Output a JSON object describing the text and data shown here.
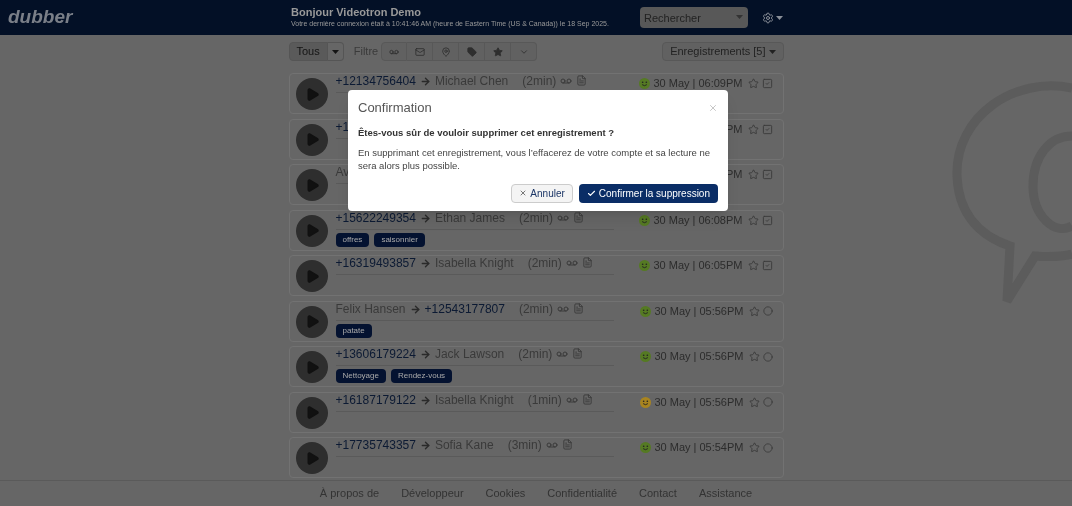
{
  "header": {
    "logo": "dubber",
    "greeting": "Bonjour Videotron Demo",
    "last_login": "Votre dernière connexion était à 10:41:46 AM (heure de Eastern Time (US & Canada)) le 18 Sep 2025.",
    "search": {
      "placeholder": "Rechercher"
    }
  },
  "toolbar": {
    "scope": "Tous",
    "filter_label": "Filtre",
    "recordings": "Enregistrements [5]"
  },
  "rows": [
    {
      "parties": [
        {
          "text": "+12134756404",
          "kind": "number"
        },
        {
          "text": "Michael Chen",
          "kind": "name"
        }
      ],
      "duration": "(2min)",
      "color": "#557a23",
      "date": "30 May | 06:09PM",
      "checked": true,
      "tags": []
    },
    {
      "parties": [
        {
          "text": "+1",
          "kind": "number"
        }
      ],
      "date": "PM",
      "checked": true,
      "tags": []
    },
    {
      "parties": [
        {
          "text": "Av",
          "kind": "name"
        }
      ],
      "date": "PM",
      "checked": true,
      "tags": []
    },
    {
      "parties": [
        {
          "text": "+15622249354",
          "kind": "number"
        },
        {
          "text": "Ethan James",
          "kind": "name"
        }
      ],
      "duration": "(2min)",
      "color": "#557a23",
      "date": "30 May | 06:08PM",
      "checked": true,
      "tags": [
        "offres",
        "saisonnier"
      ]
    },
    {
      "parties": [
        {
          "text": "+16319493857",
          "kind": "number"
        },
        {
          "text": "Isabella Knight",
          "kind": "name"
        }
      ],
      "duration": "(2min)",
      "color": "#557a23",
      "date": "30 May | 06:05PM",
      "checked": true,
      "tags": []
    },
    {
      "parties": [
        {
          "text": "Felix Hansen",
          "kind": "name"
        },
        {
          "text": "+12543177807",
          "kind": "number"
        }
      ],
      "duration": "(2min)",
      "color": "#557a23",
      "date": "30 May | 05:56PM",
      "checked": false,
      "tags": [
        "patate"
      ]
    },
    {
      "parties": [
        {
          "text": "+13606179224",
          "kind": "number"
        },
        {
          "text": "Jack Lawson",
          "kind": "name"
        }
      ],
      "duration": "(2min)",
      "color": "#557a23",
      "date": "30 May | 05:56PM",
      "checked": false,
      "tags": [
        "Nettoyage",
        "Rendez-vous"
      ]
    },
    {
      "parties": [
        {
          "text": "+16187179122",
          "kind": "number"
        },
        {
          "text": "Isabella Knight",
          "kind": "name"
        }
      ],
      "duration": "(1min)",
      "color": "#a88420",
      "date": "30 May | 05:56PM",
      "checked": false,
      "tags": []
    },
    {
      "parties": [
        {
          "text": "+17735743357",
          "kind": "number"
        },
        {
          "text": "Sofia Kane",
          "kind": "name"
        }
      ],
      "duration": "(3min)",
      "color": "#557a23",
      "date": "30 May | 05:54PM",
      "checked": false,
      "tags": []
    }
  ],
  "footer": [
    "À propos de",
    "Développeur",
    "Cookies",
    "Confidentialité",
    "Contact",
    "Assistance"
  ],
  "modal": {
    "title": "Confirmation",
    "question": "Êtes-vous sûr de vouloir supprimer cet enregistrement ?",
    "message": "En supprimant cet enregistrement, vous l’effacerez de votre compte et sa lecture ne sera alors plus possible.",
    "cancel": "Annuler",
    "confirm": "Confirmer la suppression"
  }
}
